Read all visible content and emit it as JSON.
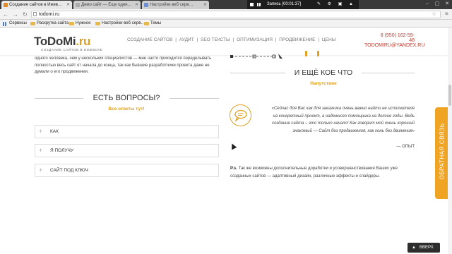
{
  "browser": {
    "tabs": [
      {
        "label": "Создание сайтов в Ижев…",
        "active": true
      },
      {
        "label": "Демо сайт — Еще один…",
        "active": false
      },
      {
        "label": "Настройки веб серв…",
        "active": false
      }
    ],
    "recording": {
      "label": "Запись [00:01:37]"
    },
    "url": "todomi.ru",
    "bookmarks": [
      {
        "label": "Сервисы",
        "icon": "apps-icon"
      },
      {
        "label": "Раскрутка сайта",
        "icon": "folder-icon"
      },
      {
        "label": "Нужное",
        "icon": "folder-icon"
      },
      {
        "label": "Настройки веб серв…",
        "icon": "folder-icon"
      },
      {
        "label": "Темы",
        "icon": "folder-icon"
      }
    ]
  },
  "header": {
    "logo_main": "ToDoMi",
    "logo_accent": ".ru",
    "logo_sub": "СОЗДАНИЕ САЙТОВ В ИЖЕВСКЕ",
    "nav": [
      "СОЗДАНИЕ САЙТОВ",
      "АУДИТ",
      "SEO ТЕКСТЫ",
      "ОПТИМИЗАЦИЯ",
      "ПРОДВИЖЕНИЕ",
      "ЦЕНЫ"
    ],
    "nav_separator": " | ",
    "phone": "8 (950) 162-59-48",
    "email": "TODOMIRU@YANDEX.RU"
  },
  "left": {
    "intro": "одного человека, чем у нескольких специалистов — мне часто приходится переделывать полностью весь сайт от начала до конца, так как бывшие разработчики проекта даже не думали о его продвижении.",
    "faq_title": "ЕСТЬ ВОПРОСЫ?",
    "faq_subtitle": "Все ответы тут!",
    "accordion": [
      {
        "label": "КАК"
      },
      {
        "label": "Я ПОЛУЧУ"
      },
      {
        "label": "САЙТ ПОД КЛЮЧ"
      }
    ]
  },
  "right": {
    "more_title": "И ЕЩЁ КОЕ ЧТО",
    "more_subtitle": "Напутствие",
    "quote": "«Сейчас для Вас как для заказчика очень важно найти не исполнителя на конкретный проект, а надежного помощника на долгие годы. Ведь создание сайта – это только начало! Как говорит мой очень хороший знакомый — Сайт без продвижения, как конь без движения»",
    "quote_author": "— ОПЫТ",
    "ps_label": "P.s.",
    "ps_text": "Так же возможны дополнительные доработки и усовершенствования Ваших уже созданных сайтов — адаптивный дизайн, различные эффекты и слайдеры."
  },
  "feedback_tab": "ОБРАТНАЯ СВЯЗЬ",
  "up_button": "ВВЕРХ",
  "colors": {
    "accent": "#e0a021",
    "contact": "#c0392b",
    "feedback_bg": "#f0a424"
  }
}
